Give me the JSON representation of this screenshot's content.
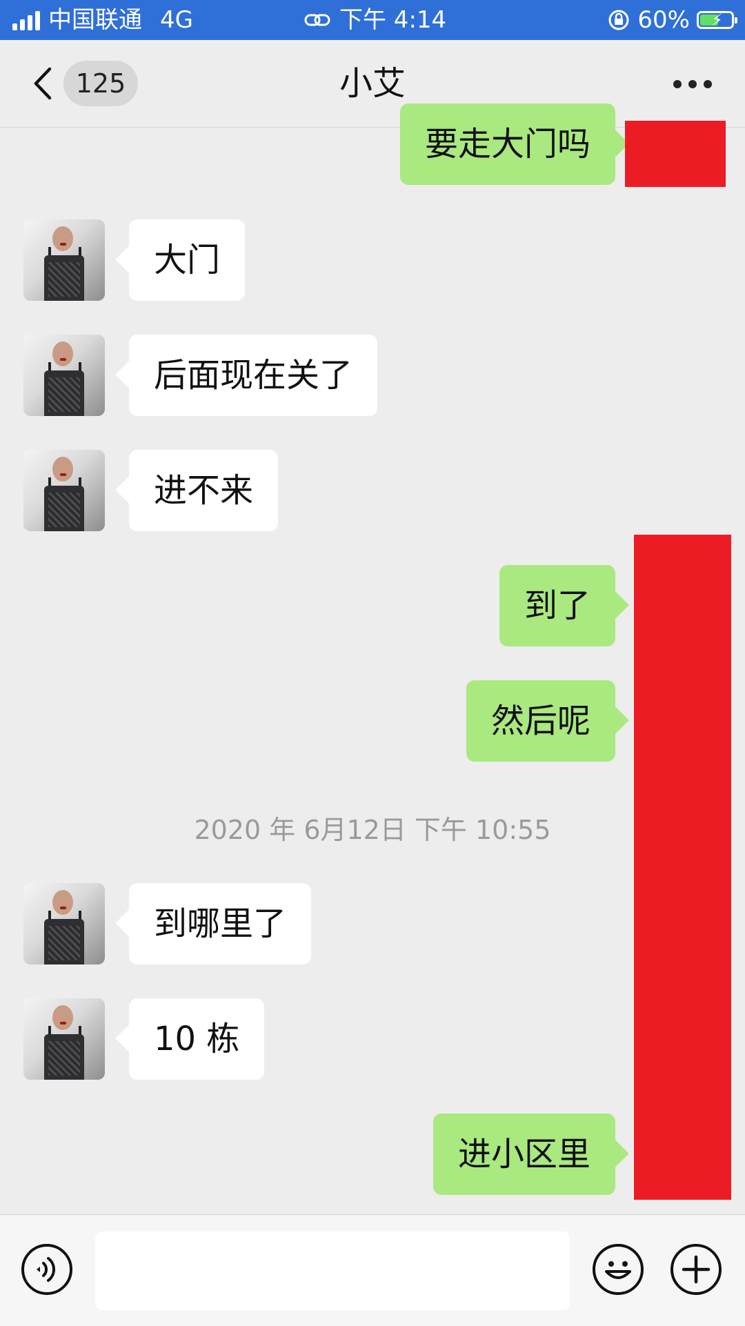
{
  "status_bar": {
    "carrier": "中国联通",
    "network": "4G",
    "time": "下午 4:14",
    "battery": "60%",
    "battery_level": 0.6
  },
  "nav": {
    "back_icon": "chevron-left-icon",
    "unread_count": "125",
    "title": "小艾",
    "more_icon": "more-dots-icon"
  },
  "messages": [
    {
      "side": "right",
      "text": "要走大门吗"
    },
    {
      "side": "left",
      "text": "大门"
    },
    {
      "side": "left",
      "text": "后面现在关了"
    },
    {
      "side": "left",
      "text": "进不来"
    },
    {
      "side": "right",
      "text": "到了"
    },
    {
      "side": "right",
      "text": "然后呢"
    },
    {
      "side": "left",
      "text": "到哪里了"
    },
    {
      "side": "left",
      "text": "10 栋"
    },
    {
      "side": "right",
      "text": "进小区里"
    }
  ],
  "timestamp": "2020 年 6月12日  下午 10:55",
  "input_bar": {
    "voice_icon": "voice-icon",
    "input_value": "",
    "emoji_icon": "emoji-icon",
    "plus_icon": "plus-icon"
  },
  "colors": {
    "status_bar": "#2f6fd8",
    "sent_bubble": "#a9e97f",
    "received_bubble": "#ffffff",
    "redaction": "#ec1c24"
  }
}
